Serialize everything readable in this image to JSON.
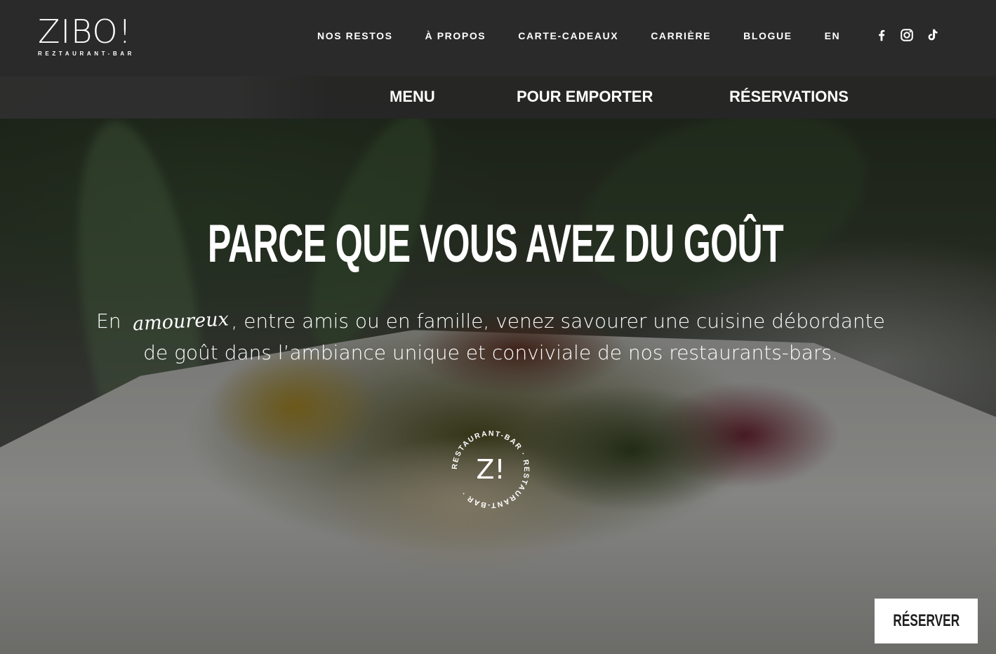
{
  "brand": {
    "name": "ZIBO!",
    "tagline": "REZTAURANT-BAR"
  },
  "top_nav": [
    {
      "label": "NOS RESTOS"
    },
    {
      "label": "À PROPOS"
    },
    {
      "label": "CARTE-CADEAUX"
    },
    {
      "label": "CARRIÈRE"
    },
    {
      "label": "BLOGUE"
    },
    {
      "label": "EN"
    }
  ],
  "social": [
    {
      "icon": "facebook-icon"
    },
    {
      "icon": "instagram-icon"
    },
    {
      "icon": "tiktok-icon"
    }
  ],
  "sub_nav": {
    "menu": "MENU",
    "takeout": "POUR EMPORTER",
    "reservations": "RÉSERVATIONS"
  },
  "hero": {
    "title": "PARCE QUE VOUS AVEZ DU GOÛT",
    "text_before": "En",
    "text_script": "amoureux",
    "text_after": ", entre amis ou en famille, venez savourer une cuisine débordante de goût dans l’ambiance unique et conviviale de nos restaurants-bars."
  },
  "badge": {
    "center": "Z!",
    "ring_text": "RESTAURANT-BAR · RESTAURANT-BAR ·"
  },
  "cta": {
    "reserve": "RÉSERVER"
  },
  "colors": {
    "header_bg": "#2a2a2a",
    "text": "#ffffff",
    "cta_bg": "#ffffff",
    "cta_text": "#1e1e1e"
  }
}
